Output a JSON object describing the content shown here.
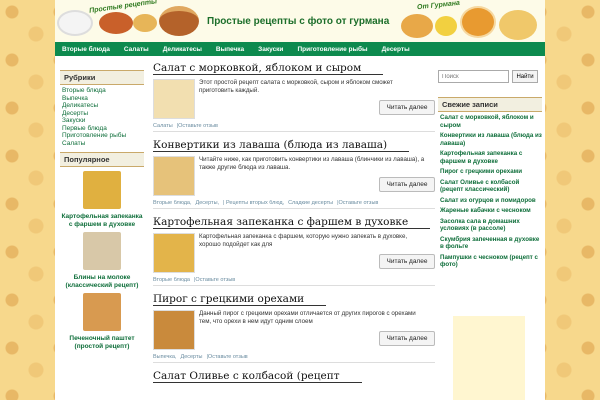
{
  "header": {
    "logo_left_text": "Простые рецепты",
    "site_title": "Простые рецепты с фото от гурмана",
    "logo_right_text": "От Гурмана"
  },
  "nav": [
    "Вторые блюда",
    "Салаты",
    "Деликатесы",
    "Выпечка",
    "Закуски",
    "Приготовление рыбы",
    "Десерты"
  ],
  "sidebar_left": {
    "rubrics_title": "Рубрики",
    "rubrics": [
      "Вторые блюда",
      "Выпечка",
      "Деликатесы",
      "Десерты",
      "Закуски",
      "Первые блюда",
      "Приготовление рыбы",
      "Салаты"
    ],
    "popular_title": "Популярное",
    "popular": [
      {
        "label": "Картофельная запеканка с фаршем в духовке",
        "color": "#e0b040"
      },
      {
        "label": "Блины на молоке (классический рецепт)",
        "color": "#d8c8a8"
      },
      {
        "label": "Печеночный паштет (простой рецепт)",
        "color": "#d89a50"
      }
    ]
  },
  "posts": [
    {
      "title": "Салат с морковкой, яблоком и сыром",
      "text": "Этот простой рецепт салата с морковкой, сыром и яблоком сможет приготовить каждый.",
      "read_more": "Читать далее",
      "meta": [
        "Салаты",
        "|Оставьте отзыв"
      ],
      "thumb_color": "#f2dfb0"
    },
    {
      "title": "Конвертики из лаваша      (блюда из лаваша)",
      "text": "Читайте ниже, как приготовить конвертики из лаваша (блинчики из лаваша), а также другие блюда из лаваша.",
      "read_more": "Читать далее",
      "meta": [
        "Вторые блюда,",
        "Десерты,",
        "| Рецепты вторых блюд,",
        "Сладкие десерты",
        "|Оставьте отзыв"
      ],
      "thumb_color": "#e6c27a"
    },
    {
      "title": "Картофельная запеканка с фаршем в духовке",
      "text": "Картофельная запеканка с фаршем, которую нужно запекать в духовке, хорошо подойдет как для",
      "read_more": "Читать далее",
      "meta": [
        "Вторые блюда",
        "|Оставьте отзыв"
      ],
      "thumb_color": "#e3b44a"
    },
    {
      "title": "Пирог с грецкими орехами",
      "text": "Данный пирог с грецкими орехами отличается от других пирогов с орехами тем, что орехи в нем идут одним слоем",
      "read_more": "Читать далее",
      "meta": [
        "Выпечка,",
        "Десерты",
        "|Оставьте отзыв"
      ],
      "thumb_color": "#c98a3c"
    },
    {
      "title": "Салат Оливье с колбасой (рецепт",
      "text": "",
      "read_more": "",
      "meta": [],
      "thumb_color": "#ffffff"
    }
  ],
  "sidebar_right": {
    "search_placeholder": "Поиск",
    "search_button": "Найти",
    "recent_title": "Свежие записи",
    "recent": [
      "Салат с морковкой, яблоком и сыром",
      "Конвертики из лаваша (блюда из лаваша)",
      "Картофельная запеканка с фаршем в духовке",
      "Пирог с грецкими орехами",
      "Салат Оливье с колбасой (рецепт классический)",
      "Салат из огурцов и помидоров",
      "Жареные кабачки с чесноком",
      "Засолка сала в домашних условиях (в рассоле)",
      "Скумбрия запеченная в духовке в фольге",
      "Пампушки с чесноком (рецепт с фото)"
    ]
  },
  "colors": {
    "nav": "#0d8a4e",
    "link": "#0e6e3a",
    "title_green": "#1c6e2a"
  }
}
